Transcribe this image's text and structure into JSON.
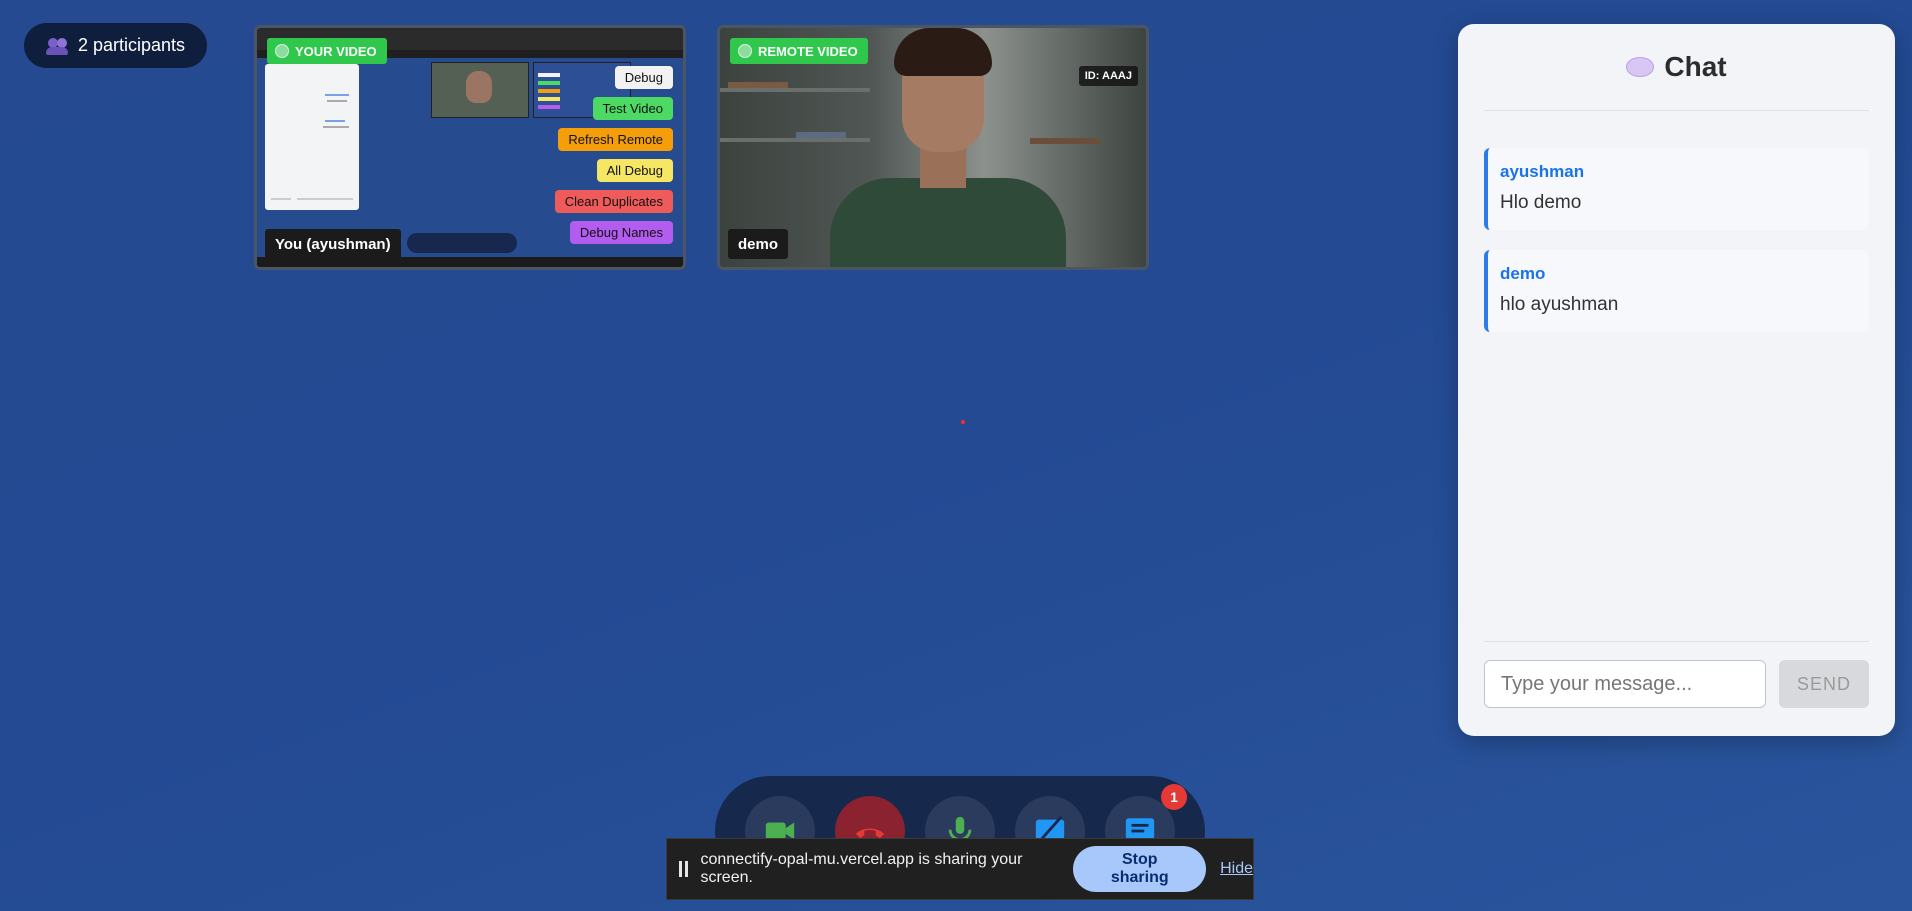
{
  "participants": {
    "label": "2 participants",
    "icon": "people-icon"
  },
  "local_video": {
    "badge": "YOUR VIDEO",
    "name": "You (ayushman)",
    "debug_buttons": [
      {
        "label": "Debug",
        "color": "#f2f2f2"
      },
      {
        "label": "Test Video",
        "color": "#4cd964"
      },
      {
        "label": "Refresh Remote",
        "color": "#f59e0b"
      },
      {
        "label": "All Debug",
        "color": "#f5e663"
      },
      {
        "label": "Clean Duplicates",
        "color": "#ef5b5b"
      },
      {
        "label": "Debug Names",
        "color": "#b35cf0"
      }
    ]
  },
  "remote_video": {
    "badge": "REMOTE VIDEO",
    "name": "demo",
    "id_label": "ID: AAAJ"
  },
  "chat": {
    "title": "Chat",
    "messages": [
      {
        "user": "ayushman",
        "text": "Hlo demo"
      },
      {
        "user": "demo",
        "text": "hlo ayushman"
      }
    ],
    "input_placeholder": "Type your message...",
    "send_label": "SEND"
  },
  "controls": [
    {
      "name": "camera-toggle",
      "icon": "video-camera-icon",
      "color": "#4caf50"
    },
    {
      "name": "end-call",
      "icon": "phone-hangup-icon",
      "color": "#e53935"
    },
    {
      "name": "mic-toggle",
      "icon": "microphone-icon",
      "color": "#4caf50"
    },
    {
      "name": "screen-share-toggle",
      "icon": "screen-share-off-icon",
      "color": "#2196f3"
    },
    {
      "name": "chat-toggle",
      "icon": "chat-icon",
      "color": "#2196f3"
    }
  ],
  "chat_notification_count": "1",
  "share_bar": {
    "message": "connectify-opal-mu.vercel.app is sharing your screen.",
    "stop_label": "Stop sharing",
    "hide_label": "Hide"
  },
  "colors": {
    "background": "#254a92",
    "accent": "#1a73e8",
    "badge_green": "#2fc84d"
  }
}
